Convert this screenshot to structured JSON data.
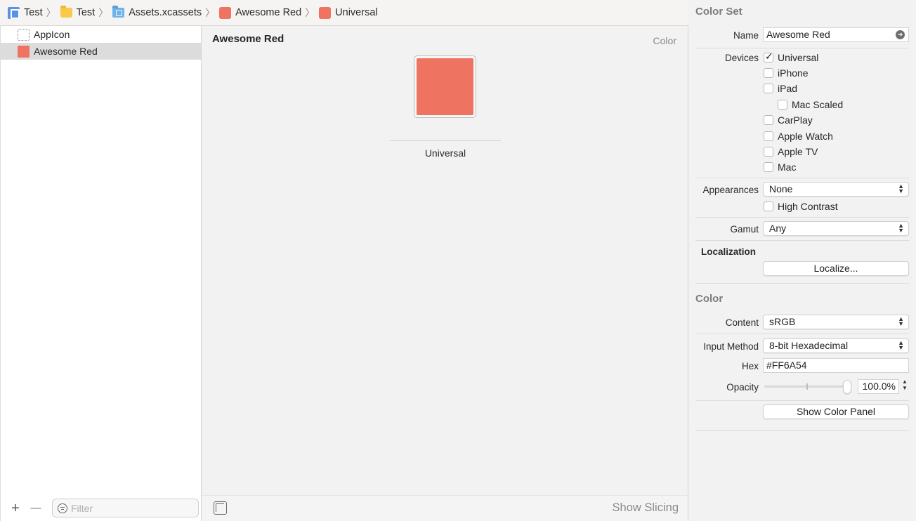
{
  "breadcrumb": [
    {
      "label": "Test",
      "icon": "project-icon"
    },
    {
      "label": "Test",
      "icon": "folder-icon"
    },
    {
      "label": "Assets.xcassets",
      "icon": "asset-catalog-icon"
    },
    {
      "label": "Awesome Red",
      "icon": "color-set-icon"
    },
    {
      "label": "Universal",
      "icon": "color-swatch-icon"
    }
  ],
  "navigator": {
    "items": [
      {
        "label": "AppIcon",
        "selected": false
      },
      {
        "label": "Awesome Red",
        "selected": true
      }
    ],
    "add_symbol": "+",
    "remove_symbol": "—",
    "filter_placeholder": "Filter"
  },
  "canvas": {
    "title": "Awesome Red",
    "kind": "Color",
    "swatch_label": "Universal",
    "swatch_color": "#EE7360",
    "show_slicing": "Show Slicing"
  },
  "inspector": {
    "color_set": {
      "section_title": "Color Set",
      "name_label": "Name",
      "name_value": "Awesome Red",
      "devices_label": "Devices",
      "devices": [
        {
          "label": "Universal",
          "checked": true
        },
        {
          "label": "iPhone",
          "checked": false
        },
        {
          "label": "iPad",
          "checked": false
        },
        {
          "label": "Mac Scaled",
          "checked": false
        },
        {
          "label": "CarPlay",
          "checked": false
        },
        {
          "label": "Apple Watch",
          "checked": false
        },
        {
          "label": "Apple TV",
          "checked": false
        },
        {
          "label": "Mac",
          "checked": false
        }
      ],
      "appearances_label": "Appearances",
      "appearances_value": "None",
      "high_contrast_label": "High Contrast",
      "gamut_label": "Gamut",
      "gamut_value": "Any",
      "localization_label": "Localization",
      "localize_button": "Localize..."
    },
    "color": {
      "section_title": "Color",
      "content_label": "Content",
      "content_value": "sRGB",
      "input_method_label": "Input Method",
      "input_method_value": "8-bit Hexadecimal",
      "hex_label": "Hex",
      "hex_value": "#FF6A54",
      "opacity_label": "Opacity",
      "opacity_value": "100.0%",
      "opacity_fraction": 1.0,
      "show_color_panel": "Show Color Panel"
    }
  }
}
